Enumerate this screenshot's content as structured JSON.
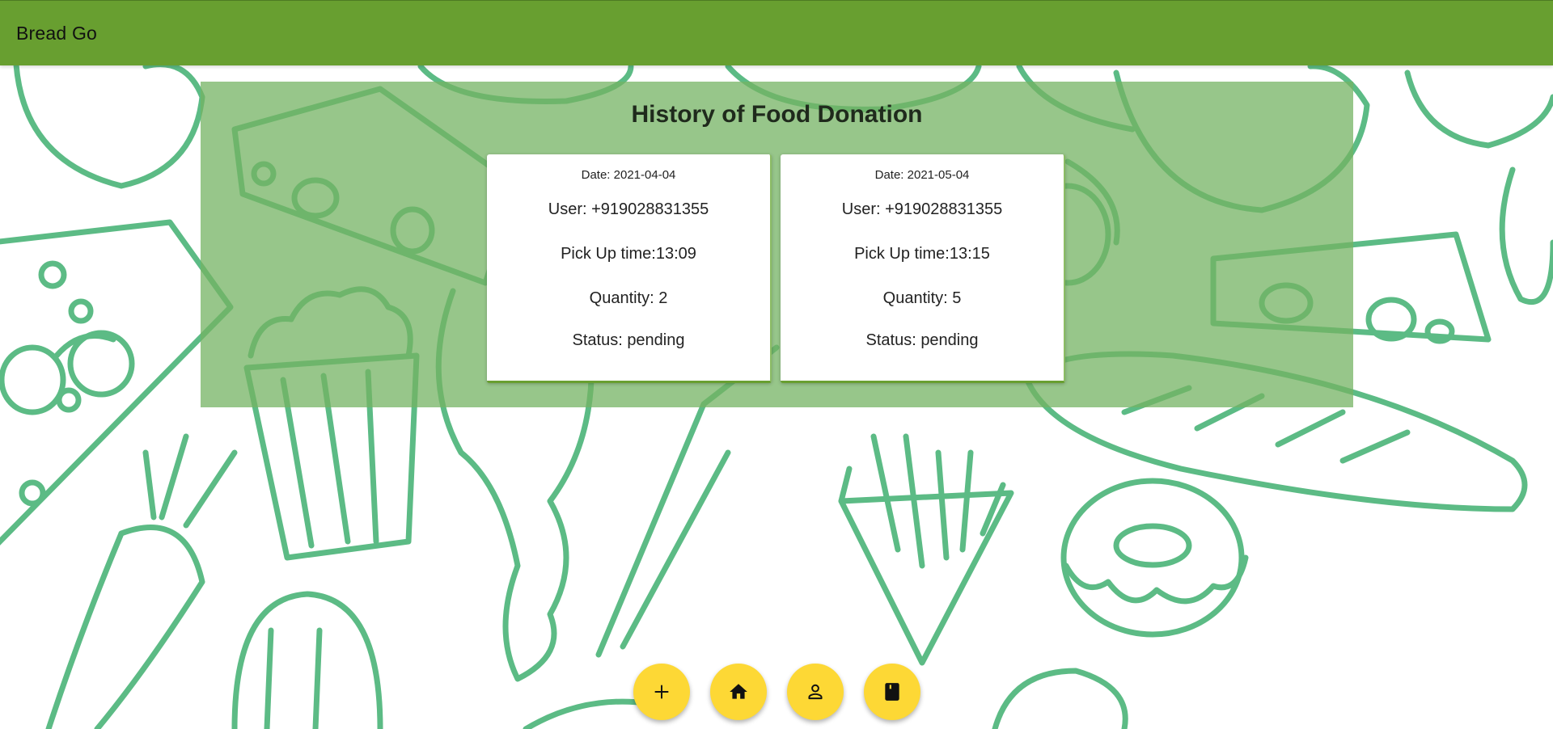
{
  "app": {
    "title": "Bread Go"
  },
  "history": {
    "title": "History of Food Donation",
    "donations": [
      {
        "date": "Date: 2021-04-04",
        "user": "User: +919028831355",
        "pickup": "Pick Up time:13:09",
        "quantity": "Quantity: 2",
        "status": "Status: pending"
      },
      {
        "date": "Date: 2021-05-04",
        "user": "User: +919028831355",
        "pickup": "Pick Up time:13:15",
        "quantity": "Quantity: 5",
        "status": "Status: pending"
      }
    ]
  },
  "fabs": [
    {
      "icon": "plus-icon"
    },
    {
      "icon": "home-icon"
    },
    {
      "icon": "person-icon"
    },
    {
      "icon": "book-icon"
    }
  ],
  "colors": {
    "app_bar": "#689f30",
    "panel": "#74b363",
    "fab": "#fdd835",
    "doodle": "#5cbb85"
  }
}
